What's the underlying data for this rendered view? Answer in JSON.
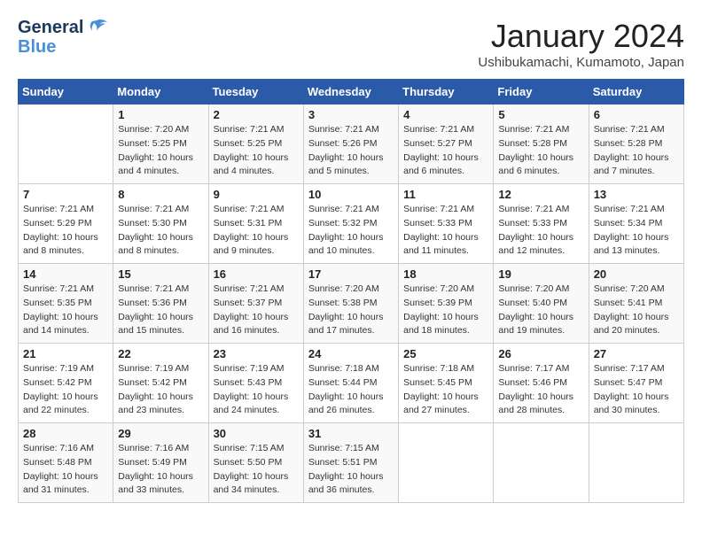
{
  "header": {
    "logo_line1": "General",
    "logo_line2": "Blue",
    "title": "January 2024",
    "subtitle": "Ushibukamachi, Kumamoto, Japan"
  },
  "weekdays": [
    "Sunday",
    "Monday",
    "Tuesday",
    "Wednesday",
    "Thursday",
    "Friday",
    "Saturday"
  ],
  "weeks": [
    [
      {
        "day": "",
        "info": ""
      },
      {
        "day": "1",
        "info": "Sunrise: 7:20 AM\nSunset: 5:25 PM\nDaylight: 10 hours\nand 4 minutes."
      },
      {
        "day": "2",
        "info": "Sunrise: 7:21 AM\nSunset: 5:25 PM\nDaylight: 10 hours\nand 4 minutes."
      },
      {
        "day": "3",
        "info": "Sunrise: 7:21 AM\nSunset: 5:26 PM\nDaylight: 10 hours\nand 5 minutes."
      },
      {
        "day": "4",
        "info": "Sunrise: 7:21 AM\nSunset: 5:27 PM\nDaylight: 10 hours\nand 6 minutes."
      },
      {
        "day": "5",
        "info": "Sunrise: 7:21 AM\nSunset: 5:28 PM\nDaylight: 10 hours\nand 6 minutes."
      },
      {
        "day": "6",
        "info": "Sunrise: 7:21 AM\nSunset: 5:28 PM\nDaylight: 10 hours\nand 7 minutes."
      }
    ],
    [
      {
        "day": "7",
        "info": "Sunrise: 7:21 AM\nSunset: 5:29 PM\nDaylight: 10 hours\nand 8 minutes."
      },
      {
        "day": "8",
        "info": "Sunrise: 7:21 AM\nSunset: 5:30 PM\nDaylight: 10 hours\nand 8 minutes."
      },
      {
        "day": "9",
        "info": "Sunrise: 7:21 AM\nSunset: 5:31 PM\nDaylight: 10 hours\nand 9 minutes."
      },
      {
        "day": "10",
        "info": "Sunrise: 7:21 AM\nSunset: 5:32 PM\nDaylight: 10 hours\nand 10 minutes."
      },
      {
        "day": "11",
        "info": "Sunrise: 7:21 AM\nSunset: 5:33 PM\nDaylight: 10 hours\nand 11 minutes."
      },
      {
        "day": "12",
        "info": "Sunrise: 7:21 AM\nSunset: 5:33 PM\nDaylight: 10 hours\nand 12 minutes."
      },
      {
        "day": "13",
        "info": "Sunrise: 7:21 AM\nSunset: 5:34 PM\nDaylight: 10 hours\nand 13 minutes."
      }
    ],
    [
      {
        "day": "14",
        "info": "Sunrise: 7:21 AM\nSunset: 5:35 PM\nDaylight: 10 hours\nand 14 minutes."
      },
      {
        "day": "15",
        "info": "Sunrise: 7:21 AM\nSunset: 5:36 PM\nDaylight: 10 hours\nand 15 minutes."
      },
      {
        "day": "16",
        "info": "Sunrise: 7:21 AM\nSunset: 5:37 PM\nDaylight: 10 hours\nand 16 minutes."
      },
      {
        "day": "17",
        "info": "Sunrise: 7:20 AM\nSunset: 5:38 PM\nDaylight: 10 hours\nand 17 minutes."
      },
      {
        "day": "18",
        "info": "Sunrise: 7:20 AM\nSunset: 5:39 PM\nDaylight: 10 hours\nand 18 minutes."
      },
      {
        "day": "19",
        "info": "Sunrise: 7:20 AM\nSunset: 5:40 PM\nDaylight: 10 hours\nand 19 minutes."
      },
      {
        "day": "20",
        "info": "Sunrise: 7:20 AM\nSunset: 5:41 PM\nDaylight: 10 hours\nand 20 minutes."
      }
    ],
    [
      {
        "day": "21",
        "info": "Sunrise: 7:19 AM\nSunset: 5:42 PM\nDaylight: 10 hours\nand 22 minutes."
      },
      {
        "day": "22",
        "info": "Sunrise: 7:19 AM\nSunset: 5:42 PM\nDaylight: 10 hours\nand 23 minutes."
      },
      {
        "day": "23",
        "info": "Sunrise: 7:19 AM\nSunset: 5:43 PM\nDaylight: 10 hours\nand 24 minutes."
      },
      {
        "day": "24",
        "info": "Sunrise: 7:18 AM\nSunset: 5:44 PM\nDaylight: 10 hours\nand 26 minutes."
      },
      {
        "day": "25",
        "info": "Sunrise: 7:18 AM\nSunset: 5:45 PM\nDaylight: 10 hours\nand 27 minutes."
      },
      {
        "day": "26",
        "info": "Sunrise: 7:17 AM\nSunset: 5:46 PM\nDaylight: 10 hours\nand 28 minutes."
      },
      {
        "day": "27",
        "info": "Sunrise: 7:17 AM\nSunset: 5:47 PM\nDaylight: 10 hours\nand 30 minutes."
      }
    ],
    [
      {
        "day": "28",
        "info": "Sunrise: 7:16 AM\nSunset: 5:48 PM\nDaylight: 10 hours\nand 31 minutes."
      },
      {
        "day": "29",
        "info": "Sunrise: 7:16 AM\nSunset: 5:49 PM\nDaylight: 10 hours\nand 33 minutes."
      },
      {
        "day": "30",
        "info": "Sunrise: 7:15 AM\nSunset: 5:50 PM\nDaylight: 10 hours\nand 34 minutes."
      },
      {
        "day": "31",
        "info": "Sunrise: 7:15 AM\nSunset: 5:51 PM\nDaylight: 10 hours\nand 36 minutes."
      },
      {
        "day": "",
        "info": ""
      },
      {
        "day": "",
        "info": ""
      },
      {
        "day": "",
        "info": ""
      }
    ]
  ]
}
